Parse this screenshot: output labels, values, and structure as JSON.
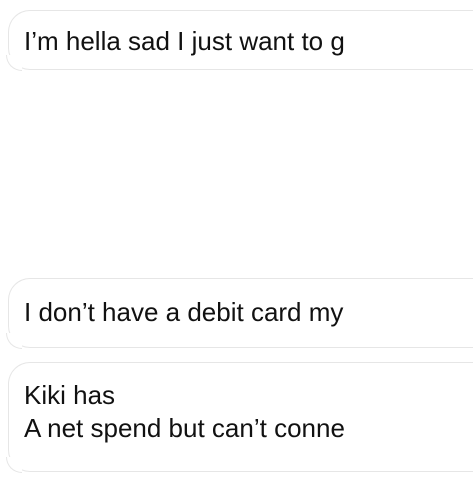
{
  "messages": [
    {
      "lines": [
        "I’m hella sad I just want to g"
      ]
    },
    {
      "lines": [
        "I don’t have a debit card my"
      ]
    },
    {
      "lines": [
        "Kiki has",
        "A net spend but can’t conne"
      ]
    }
  ]
}
